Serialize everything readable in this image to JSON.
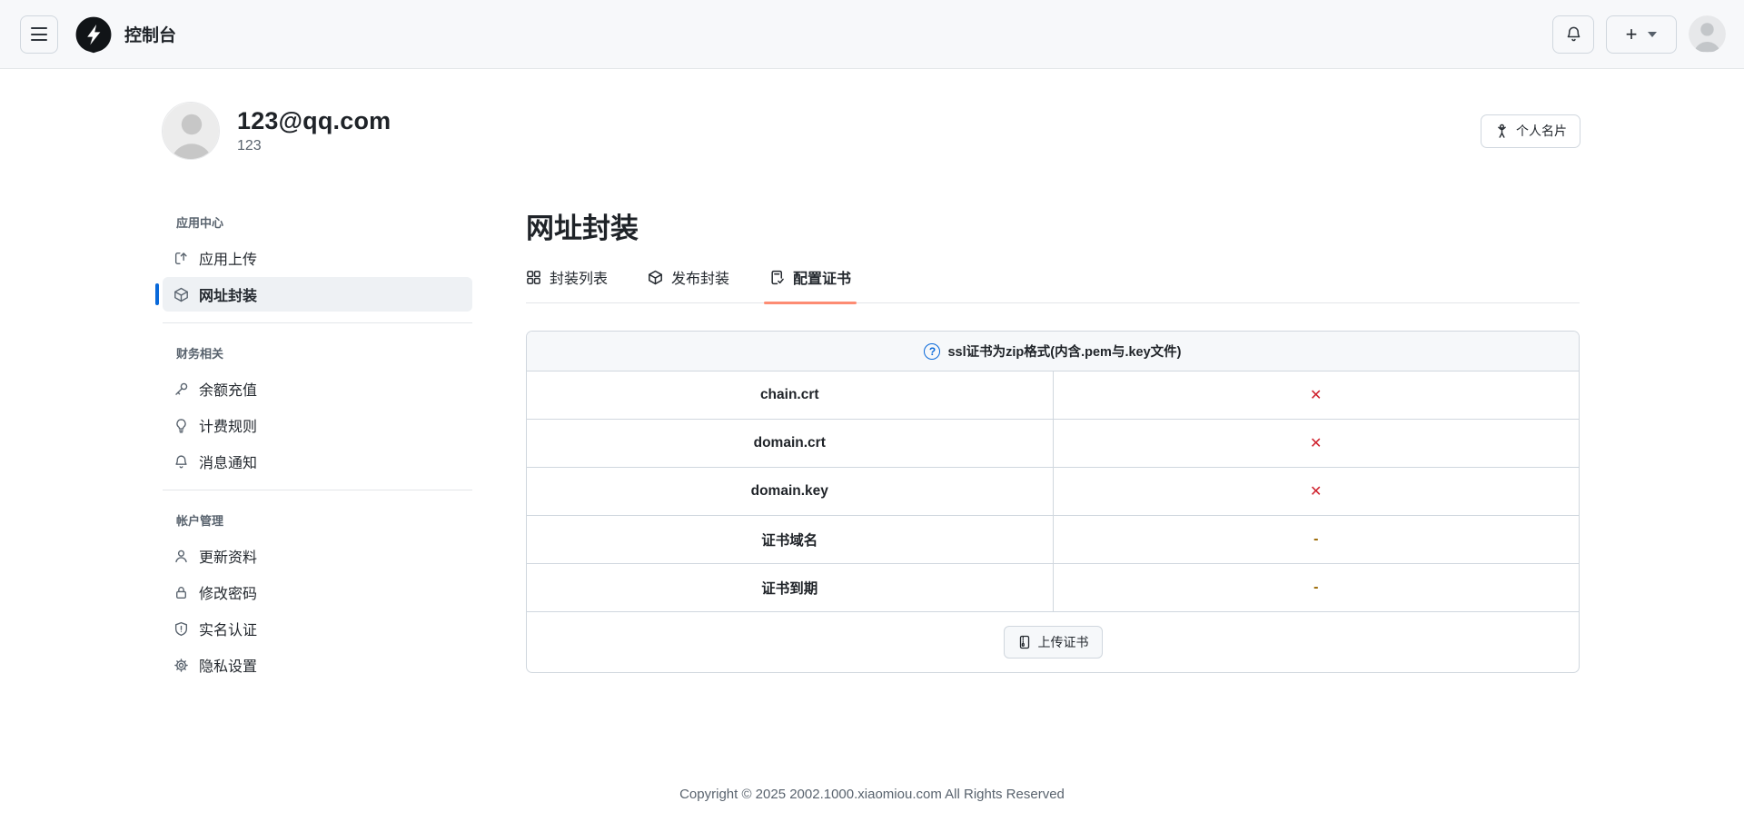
{
  "colors": {
    "accent": "#0969da",
    "danger": "#cf222e",
    "attention": "#9a6700",
    "tab_underline": "#fd8c73"
  },
  "header": {
    "title": "控制台",
    "menu_icon": "hamburger-icon",
    "logo_icon": "lightning-logo",
    "bell_icon": "bell-icon",
    "new_button_plus": "+",
    "avatar_icon": "user-avatar"
  },
  "profile": {
    "email": "123@qq.com",
    "username": "123",
    "card_button_label": "个人名片",
    "card_button_icon": "person-card-icon"
  },
  "sidebar": {
    "sections": [
      {
        "title": "应用中心",
        "items": [
          {
            "label": "应用上传",
            "icon": "upload-icon",
            "active": false
          },
          {
            "label": "网址封装",
            "icon": "package-icon",
            "active": true
          }
        ]
      },
      {
        "title": "财务相关",
        "items": [
          {
            "label": "余额充值",
            "icon": "key-icon",
            "active": false
          },
          {
            "label": "计费规则",
            "icon": "lightbulb-icon",
            "active": false
          },
          {
            "label": "消息通知",
            "icon": "bell-icon",
            "active": false
          }
        ]
      },
      {
        "title": "帐户管理",
        "items": [
          {
            "label": "更新资料",
            "icon": "person-icon",
            "active": false
          },
          {
            "label": "修改密码",
            "icon": "lock-icon",
            "active": false
          },
          {
            "label": "实名认证",
            "icon": "shield-icon",
            "active": false
          },
          {
            "label": "隐私设置",
            "icon": "gear-icon",
            "active": false
          }
        ]
      }
    ]
  },
  "main": {
    "title": "网址封装",
    "tabs": [
      {
        "label": "封装列表",
        "icon": "grid-icon",
        "active": false
      },
      {
        "label": "发布封装",
        "icon": "package-icon",
        "active": false
      },
      {
        "label": "配置证书",
        "icon": "file-check-icon",
        "active": true
      }
    ],
    "certificate_table": {
      "notice": "ssl证书为zip格式(内含.pem与.key文件)",
      "notice_icon": "question-circle-icon",
      "rows": [
        {
          "label": "chain.crt",
          "status": "✕",
          "state": "missing"
        },
        {
          "label": "domain.crt",
          "status": "✕",
          "state": "missing"
        },
        {
          "label": "domain.key",
          "status": "✕",
          "state": "missing"
        },
        {
          "label": "证书域名",
          "status": "-",
          "state": "empty"
        },
        {
          "label": "证书到期",
          "status": "-",
          "state": "empty"
        }
      ],
      "upload_button_label": "上传证书",
      "upload_button_icon": "file-zip-icon"
    }
  },
  "footer": {
    "copyright": "Copyright © 2025 2002.1000.xiaomiou.com All Rights Reserved"
  }
}
